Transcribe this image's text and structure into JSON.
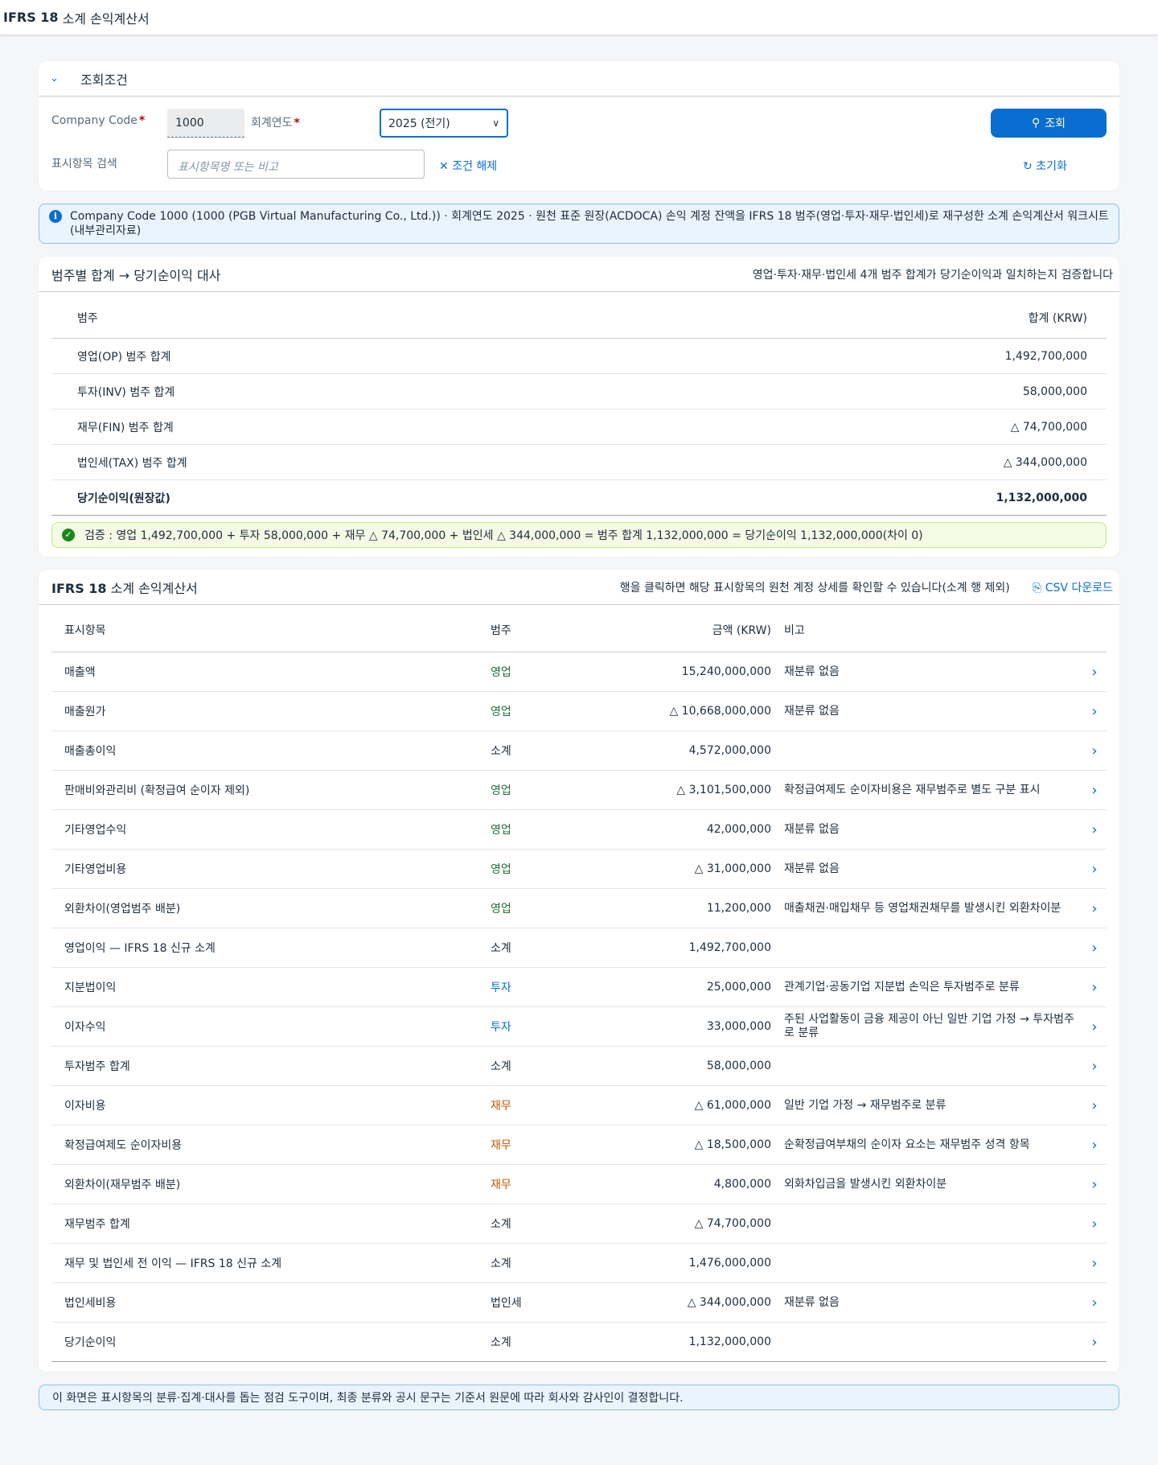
{
  "app": {
    "title_bold": "IFRS 18",
    "title_rest": "소계 손익계산서"
  },
  "filter": {
    "header": "조회조건",
    "company_label": "Company Code",
    "company_value": "1000",
    "year_label": "회계연도",
    "year_value": "2025 (전기)",
    "search_label": "표시항목 검색",
    "search_placeholder": "표시항목명 또는 비고",
    "clear_label": "조건 해제",
    "go_label": "조회",
    "reset_label": "초기화"
  },
  "info_text": "Company Code 1000 (1000 (PGB Virtual Manufacturing Co., Ltd.)) · 회계연도 2025 · 원천 표준 원장(ACDOCA) 손익 계정 잔액을 IFRS 18 범주(영업·투자·재무·법인세)로 재구성한 소계 손익계산서 워크시트(내부관리자료)",
  "category_section": {
    "title": "범주별 합계 → 당기순이익 대사",
    "subtitle": "영업·투자·재무·법인세 4개 범주 합계가 당기순이익과 일치하는지 검증합니다",
    "col_category": "범주",
    "col_total": "합계 (KRW)",
    "rows": [
      {
        "label": "영업(OP) 범주 합계",
        "value": "1,492,700,000"
      },
      {
        "label": "투자(INV) 범주 합계",
        "value": "58,000,000"
      },
      {
        "label": "재무(FIN) 범주 합계",
        "value": "△ 74,700,000"
      },
      {
        "label": "법인세(TAX) 범주 합계",
        "value": "△ 344,000,000"
      }
    ],
    "total": {
      "label": "당기순이익(원장값)",
      "value": "1,132,000,000"
    },
    "validation": "검증 : 영업 1,492,700,000 + 투자 58,000,000 + 재무 △ 74,700,000 + 법인세 △ 344,000,000 = 범주 합계 1,132,000,000 = 당기순이익 1,132,000,000(차이 0)"
  },
  "statement": {
    "title_bold": "IFRS 18",
    "title_rest": "소계 손익계산서",
    "hint": "행을 클릭하면 해당 표시항목의 원천 계정 상세를 확인할 수 있습니다(소계 행 제외)",
    "csv_label": "CSV 다운로드",
    "columns": {
      "item": "표시항목",
      "category": "범주",
      "amount": "금액 (KRW)",
      "note": "비고"
    },
    "rows": [
      {
        "item": "매출액",
        "category": "영업",
        "amount": "15,240,000,000",
        "note": "재분류 없음"
      },
      {
        "item": "매출원가",
        "category": "영업",
        "amount": "△ 10,668,000,000",
        "note": "재분류 없음"
      },
      {
        "item": "매출총이익",
        "category": "소계",
        "amount": "4,572,000,000",
        "note": ""
      },
      {
        "item": "판매비와관리비 (확정급여 순이자 제외)",
        "category": "영업",
        "amount": "△ 3,101,500,000",
        "note": "확정급여제도 순이자비용은 재무범주로 별도 구분 표시"
      },
      {
        "item": "기타영업수익",
        "category": "영업",
        "amount": "42,000,000",
        "note": "재분류 없음"
      },
      {
        "item": "기타영업비용",
        "category": "영업",
        "amount": "△ 31,000,000",
        "note": "재분류 없음"
      },
      {
        "item": "외환차이(영업범주 배분)",
        "category": "영업",
        "amount": "11,200,000",
        "note": "매출채권·매입채무 등 영업채권채무를 발생시킨 외환차이분"
      },
      {
        "item": "영업이익 — IFRS 18 신규 소계",
        "category": "소계",
        "amount": "1,492,700,000",
        "note": ""
      },
      {
        "item": "지분법이익",
        "category": "투자",
        "amount": "25,000,000",
        "note": "관계기업·공동기업 지분법 손익은 투자범주로 분류"
      },
      {
        "item": "이자수익",
        "category": "투자",
        "amount": "33,000,000",
        "note": "주된 사업활동이 금융 제공이 아닌 일반 기업 가정 → 투자범주로 분류"
      },
      {
        "item": "투자범주 합계",
        "category": "소계",
        "amount": "58,000,000",
        "note": ""
      },
      {
        "item": "이자비용",
        "category": "재무",
        "amount": "△ 61,000,000",
        "note": "일반 기업 가정 → 재무범주로 분류"
      },
      {
        "item": "확정급여제도 순이자비용",
        "category": "재무",
        "amount": "△ 18,500,000",
        "note": "순확정급여부채의 순이자 요소는 재무범주 성격 항목"
      },
      {
        "item": "외환차이(재무범주 배분)",
        "category": "재무",
        "amount": "4,800,000",
        "note": "외화차입금을 발생시킨 외환차이분"
      },
      {
        "item": "재무범주 합계",
        "category": "소계",
        "amount": "△ 74,700,000",
        "note": ""
      },
      {
        "item": "재무 및 법인세 전 이익 — IFRS 18 신규 소계",
        "category": "소계",
        "amount": "1,476,000,000",
        "note": ""
      },
      {
        "item": "법인세비용",
        "category": "법인세",
        "amount": "△ 344,000,000",
        "note": "재분류 없음"
      },
      {
        "item": "당기순이익",
        "category": "소계",
        "amount": "1,132,000,000",
        "note": ""
      }
    ]
  },
  "footnote": "이 화면은 표시항목의 분류·집계·대사를 돕는 점검 도구이며, 최종 분류와 공시 문구는 기준서 원문에 따라 회사와 감사인이 결정합니다.",
  "colors": {
    "accent": "#0a6ed1",
    "operating": "#256f3a",
    "investing": "#0a6ed1",
    "financing": "#c35500",
    "success": "#188918"
  }
}
